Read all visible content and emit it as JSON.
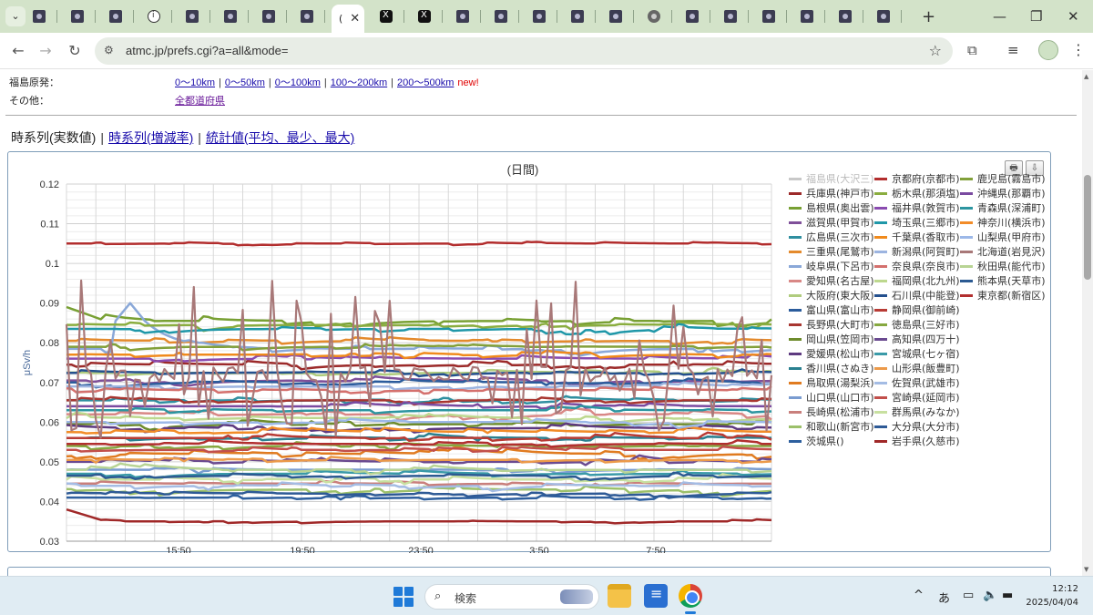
{
  "browser": {
    "url": "atmc.jp/prefs.cgi?a=all&mode=",
    "active_tab_glyph": "(",
    "close_glyph": "✕",
    "tabs": [
      {
        "icon": "site-favicon"
      },
      {
        "icon": "site-favicon"
      },
      {
        "icon": "site-favicon"
      },
      {
        "icon": "info-favicon"
      },
      {
        "icon": "site-favicon"
      },
      {
        "icon": "site-favicon"
      },
      {
        "icon": "site-favicon"
      },
      {
        "icon": "site-favicon"
      },
      {
        "icon": "site-favicon",
        "active": true
      },
      {
        "icon": "x-favicon"
      },
      {
        "icon": "x-favicon"
      },
      {
        "icon": "site-favicon"
      },
      {
        "icon": "site-favicon"
      },
      {
        "icon": "site-favicon"
      },
      {
        "icon": "site-favicon"
      },
      {
        "icon": "site-favicon"
      },
      {
        "icon": "globe-favicon"
      },
      {
        "icon": "site-favicon"
      },
      {
        "icon": "site-favicon"
      },
      {
        "icon": "site-favicon"
      },
      {
        "icon": "site-favicon"
      },
      {
        "icon": "site-favicon"
      },
      {
        "icon": "site-favicon"
      }
    ]
  },
  "filters": {
    "fukushima": {
      "label": "福島原発：",
      "links": [
        "0～10km",
        "0～50km",
        "0～100km",
        "100～200km",
        "200～500km"
      ],
      "new_badge": "new!"
    },
    "other": {
      "label": "その他：",
      "link": "全都道府県"
    }
  },
  "view_tabs": {
    "current": "時系列(実数値)",
    "links": [
      "時系列(増減率)",
      "統計値(平均、最少、最大)"
    ],
    "separator": "|"
  },
  "chart_buttons": {
    "print": "🖶",
    "download": "⇩"
  },
  "chart_data": {
    "type": "line",
    "title": "(日間)",
    "ylabel": "μSv/h",
    "ylim": [
      0.03,
      0.12
    ],
    "yticks": [
      "0.03",
      "0.04",
      "0.05",
      "0.06",
      "0.07",
      "0.08",
      "0.09",
      "0.1",
      "0.11",
      "0.12"
    ],
    "xticks": [
      "15:50",
      "19:50",
      "23:50",
      "3:50",
      "7:50"
    ],
    "grid": true,
    "legend_position": "right",
    "series": [
      {
        "name": "福島県(大沢三)",
        "color": "#c8c8c8",
        "hidden": true
      },
      {
        "name": "兵庫県(神戸市)",
        "color": "#9c2a2a",
        "base": 0.0745,
        "noise": 0.0012
      },
      {
        "name": "島根県(奥出雲)",
        "color": "#78a033",
        "base": 0.0855,
        "noise": 0.0015,
        "start": 0.089
      },
      {
        "name": "滋賀県(甲賀市)",
        "color": "#7f4f99",
        "base": 0.0705,
        "noise": 0.001
      },
      {
        "name": "広島県(三次市)",
        "color": "#2f8fa0",
        "base": 0.0655,
        "noise": 0.001
      },
      {
        "name": "三重県(尾鷲市)",
        "color": "#e48a2c",
        "base": 0.0805,
        "noise": 0.001
      },
      {
        "name": "岐阜県(下呂市)",
        "color": "#8aa8d8",
        "base": 0.0785,
        "noise": 0.0012,
        "bump": [
          10,
          16,
          0.09
        ]
      },
      {
        "name": "愛知県(名古屋)",
        "color": "#d98886",
        "base": 0.062,
        "noise": 0.0012
      },
      {
        "name": "大阪府(東大阪)",
        "color": "#b0cc7e",
        "base": 0.0725,
        "noise": 0.001
      },
      {
        "name": "富山県(富山市)",
        "color": "#2b5c9c",
        "base": 0.07,
        "noise": 0.001
      },
      {
        "name": "長野県(大町市)",
        "color": "#a83630",
        "base": 0.0655,
        "noise": 0.0008
      },
      {
        "name": "岡山県(笠岡市)",
        "color": "#6e8c2c",
        "base": 0.0595,
        "noise": 0.001
      },
      {
        "name": "愛媛県(松山市)",
        "color": "#5e3a80",
        "base": 0.0585,
        "noise": 0.001
      },
      {
        "name": "香川県(さぬき)",
        "color": "#2a8090",
        "base": 0.056,
        "noise": 0.001
      },
      {
        "name": "鳥取県(湯梨浜)",
        "color": "#e07b20",
        "base": 0.052,
        "noise": 0.0012
      },
      {
        "name": "山口県(山口市)",
        "color": "#7a9cd0",
        "base": 0.048,
        "noise": 0.001
      },
      {
        "name": "長崎県(松浦市)",
        "color": "#c97f7c",
        "base": 0.0445,
        "noise": 0.001
      },
      {
        "name": "和歌山(新宮市)",
        "color": "#9cc06a",
        "base": 0.043,
        "noise": 0.0012
      },
      {
        "name": "茨城県()",
        "color": "#2d5f9e",
        "base": 0.041,
        "noise": 0.0008
      },
      {
        "name": "京都府(京都市)",
        "color": "#b22d2d",
        "base": 0.105,
        "noise": 0.0005
      },
      {
        "name": "栃木県(那須塩)",
        "color": "#8aad3f",
        "base": 0.0845,
        "noise": 0.001
      },
      {
        "name": "福井県(敦賀市)",
        "color": "#8a4bb0",
        "base": 0.076,
        "noise": 0.001
      },
      {
        "name": "埼玉県(三郷市)",
        "color": "#1f97a8",
        "base": 0.0835,
        "noise": 0.001
      },
      {
        "name": "千葉県(香取市)",
        "color": "#f08a1c",
        "base": 0.077,
        "noise": 0.001
      },
      {
        "name": "新潟県(阿賀町)",
        "color": "#9cb4e0",
        "base": 0.069,
        "noise": 0.001
      },
      {
        "name": "奈良県(奈良市)",
        "color": "#d4706d",
        "base": 0.068,
        "noise": 0.001
      },
      {
        "name": "福岡県(北九州)",
        "color": "#bdd88e",
        "base": 0.061,
        "noise": 0.001
      },
      {
        "name": "石川県(中能登)",
        "color": "#24508e",
        "base": 0.0725,
        "noise": 0.001
      },
      {
        "name": "静岡県(御前崎)",
        "color": "#b83b35",
        "base": 0.056,
        "noise": 0.001
      },
      {
        "name": "徳島県(三好市)",
        "color": "#86a840",
        "base": 0.054,
        "noise": 0.001
      },
      {
        "name": "高知県(四万十)",
        "color": "#6a4a90",
        "base": 0.05,
        "noise": 0.001
      },
      {
        "name": "宮城県(七ヶ宿)",
        "color": "#3a9aa8",
        "base": 0.047,
        "noise": 0.001
      },
      {
        "name": "山形県(飯豊町)",
        "color": "#ec9a4a",
        "base": 0.0505,
        "noise": 0.001
      },
      {
        "name": "佐賀県(武雄市)",
        "color": "#a4bce4",
        "base": 0.044,
        "noise": 0.001
      },
      {
        "name": "宮崎県(延岡市)",
        "color": "#c24f4b",
        "base": 0.053,
        "noise": 0.001
      },
      {
        "name": "群馬県(みなか)",
        "color": "#c8e0a0",
        "base": 0.0455,
        "noise": 0.001
      },
      {
        "name": "大分県(大分市)",
        "color": "#2e5a96",
        "base": 0.042,
        "noise": 0.0008
      },
      {
        "name": "岩手県(久慈市)",
        "color": "#a02828",
        "base": 0.035,
        "noise": 0.0005,
        "start": 0.038
      },
      {
        "name": "鹿児島(霧島市)",
        "color": "#82a03a",
        "base": 0.079,
        "noise": 0.001
      },
      {
        "name": "沖縄県(那覇市)",
        "color": "#7a4aa0",
        "base": 0.064,
        "noise": 0.001
      },
      {
        "name": "青森県(深浦町)",
        "color": "#2c95a0",
        "base": 0.063,
        "noise": 0.001
      },
      {
        "name": "神奈川(横浜市)",
        "color": "#f28c28",
        "base": 0.0575,
        "noise": 0.001
      },
      {
        "name": "山梨県(甲府市)",
        "color": "#9cb8e8",
        "base": 0.06,
        "noise": 0.001
      },
      {
        "name": "北海道(岩見沢)",
        "color": "#a87878",
        "base": 0.072,
        "noise": 0.01,
        "spiky": true
      },
      {
        "name": "秋田県(能代市)",
        "color": "#b8d494",
        "base": 0.048,
        "noise": 0.001
      },
      {
        "name": "熊本県(天草市)",
        "color": "#2c5a92",
        "base": 0.0465,
        "noise": 0.001
      },
      {
        "name": "東京都(新宿区)",
        "color": "#b22f2f",
        "base": 0.0545,
        "noise": 0.0008
      }
    ]
  },
  "taskbar": {
    "search_placeholder": "検索",
    "ime": "あ",
    "time": "12:12",
    "date": "2025/04/04"
  }
}
